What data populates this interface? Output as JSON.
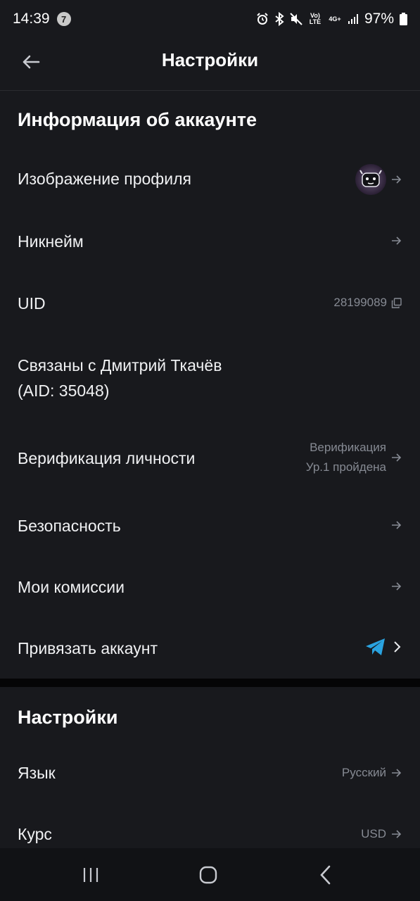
{
  "status_bar": {
    "time": "14:39",
    "notification_count": "7",
    "volte_label": "Vo) LTE",
    "network_label": "4G+",
    "battery": "97%"
  },
  "header": {
    "title": "Настройки"
  },
  "account_section": {
    "title": "Информация об аккаунте",
    "rows": {
      "profile_image": {
        "label": "Изображение профиля"
      },
      "nickname": {
        "label": "Никнейм"
      },
      "uid": {
        "label": "UID",
        "value": "28199089"
      },
      "linked": {
        "label_line1": "Связаны с Дмитрий Ткачёв",
        "label_line2": "(AID: 35048)"
      },
      "verification": {
        "label": "Верификация личности",
        "value_line1": "Верификация",
        "value_line2": "Ур.1 пройдена"
      },
      "security": {
        "label": "Безопасность"
      },
      "fees": {
        "label": "Мои комиссии"
      },
      "link_account": {
        "label": "Привязать аккаунт"
      }
    }
  },
  "settings_section": {
    "title": "Настройки",
    "rows": {
      "language": {
        "label": "Язык",
        "value": "Русский"
      },
      "rate": {
        "label": "Курс",
        "value": "USD"
      }
    }
  },
  "colors": {
    "background": "#18191d",
    "secondary_text": "#868a93",
    "telegram_blue": "#2aa3e0"
  },
  "icons": [
    "back-arrow-icon",
    "right-arrow-icon",
    "copy-icon",
    "telegram-icon",
    "chevron-right-icon",
    "recent-apps-icon",
    "home-icon",
    "back-icon"
  ]
}
